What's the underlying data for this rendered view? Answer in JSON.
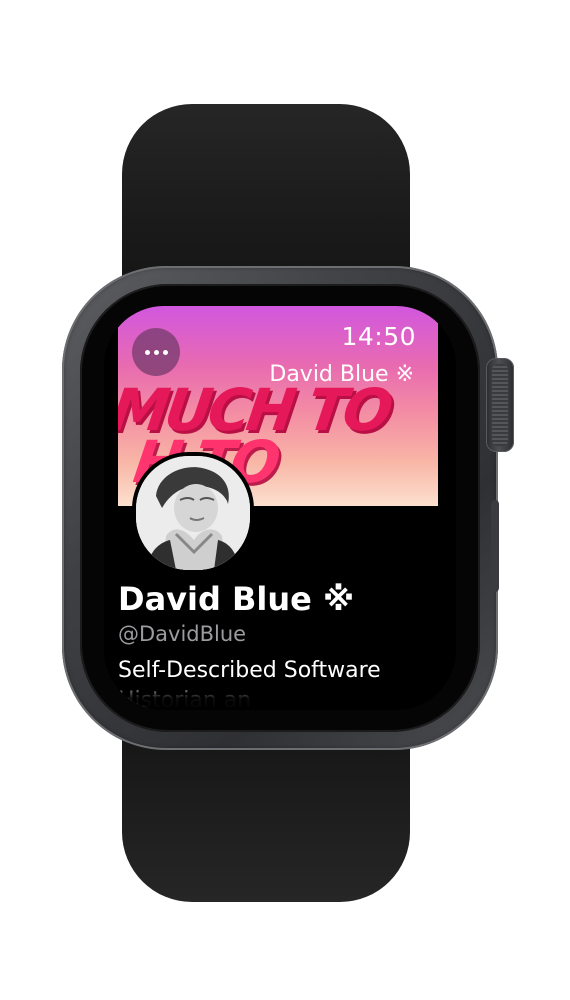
{
  "status": {
    "time": "14:50"
  },
  "nav": {
    "title": "David Blue ※",
    "more_icon": "ellipsis-icon"
  },
  "banner": {
    "art_text_line1": "MUCH TO",
    "art_text_line2": "H TO"
  },
  "profile": {
    "name": "David Blue ※",
    "handle": "@DavidBlue",
    "bio": "Self-Described Software Historian an"
  },
  "colors": {
    "banner_top": "#d157df",
    "banner_bottom": "#fce0cf",
    "banner_text": "#e5195a",
    "handle_gray": "#9b9ba0"
  }
}
